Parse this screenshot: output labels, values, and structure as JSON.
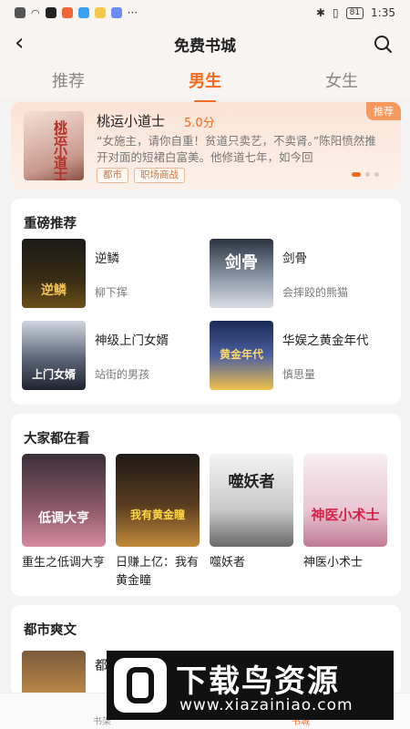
{
  "status_bar": {
    "time": "1:35",
    "battery": "81"
  },
  "header": {
    "title": "免费书城"
  },
  "tabs": [
    {
      "label": "推荐",
      "active": false
    },
    {
      "label": "男生",
      "active": true
    },
    {
      "label": "女生",
      "active": false
    }
  ],
  "featured": {
    "cover_text": "桃运小道士",
    "title": "桃运小道士",
    "score": "5.0分",
    "description": "“女施主，请你自重！贫道只卖艺，不卖肾。”陈阳愤然推开对面的短裙白富美。他修道七年，如今回",
    "tags": [
      "都市",
      "职场商战"
    ],
    "badge": "推荐"
  },
  "section_heavy": {
    "title": "重磅推荐",
    "books": [
      {
        "title": "逆鳞",
        "author": "柳下挥",
        "cover_text": "逆鳞"
      },
      {
        "title": "剑骨",
        "author": "会摔跤的熊猫",
        "cover_text": "剑骨"
      },
      {
        "title": "神级上门女婿",
        "author": "站街的男孩",
        "cover_text": "上门女婿"
      },
      {
        "title": "华娱之黄金年代",
        "author": "慎思量",
        "cover_text": "黄金年代"
      }
    ]
  },
  "section_popular": {
    "title": "大家都在看",
    "books": [
      {
        "title": "重生之低调大亨",
        "cover_text": "低调大亨"
      },
      {
        "title": "日赚上亿：我有黄金瞳",
        "cover_text": "我有黄金瞳"
      },
      {
        "title": "噬妖者",
        "cover_text": "噬妖者"
      },
      {
        "title": "神医小术士",
        "cover_text": "神医小术士"
      }
    ]
  },
  "section_city": {
    "title": "都市爽文",
    "first_book_partial": "都"
  },
  "bottom_nav": {
    "left_label": "书架",
    "right_label": "书城"
  },
  "watermark": {
    "big": "下载鸟资源",
    "url": "www.xiazainiao.com"
  },
  "colors": {
    "accent": "#f26b21",
    "badge": "#f59a5e"
  }
}
